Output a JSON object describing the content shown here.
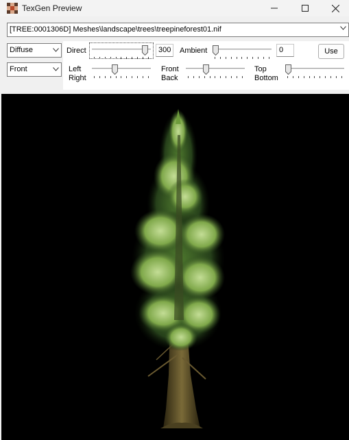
{
  "window": {
    "title": "TexGen Preview"
  },
  "record_path": "[TREE:0001306D] Meshes\\landscape\\trees\\treepineforest01.nif",
  "render_mode": "Diffuse",
  "view_mode": "Front",
  "lighting": {
    "direct": {
      "label": "Direct",
      "value": "300",
      "level": 0.95
    },
    "ambient": {
      "label": "Ambient",
      "value": "0",
      "level": 0.0
    },
    "left_right": {
      "label_top": "Left",
      "label_bottom": "Right",
      "level": 0.38
    },
    "front_back": {
      "label_top": "Front",
      "label_bottom": "Back",
      "level": 0.33
    },
    "top_bottom": {
      "label_top": "Top",
      "label_bottom": "Bottom",
      "level": 0.0
    }
  },
  "use_button": "Use",
  "preview": {
    "subject": "pine tree model",
    "background": "#000000",
    "foliage_colors": [
      "#2d4a1e",
      "#6e9c3c",
      "#b5d58a"
    ],
    "trunk_color": "#6b5a2e"
  }
}
